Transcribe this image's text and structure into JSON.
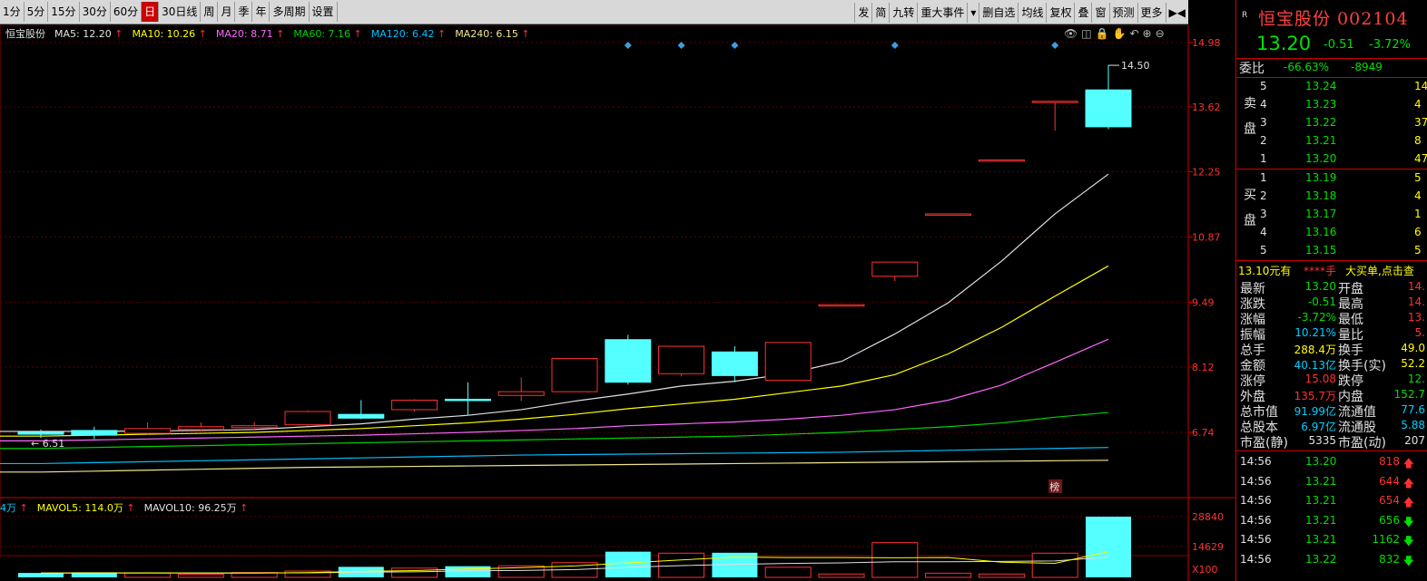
{
  "toolbar": {
    "left": [
      "1分",
      "5分",
      "15分",
      "30分",
      "60分",
      "日",
      "30日线",
      "周",
      "月",
      "季",
      "年",
      "多周期",
      "设置"
    ],
    "active_index": 5,
    "right": [
      "发",
      "简",
      "九转",
      "重大事件",
      "▾",
      "删自选",
      "均线",
      "复权",
      "叠",
      "窗",
      "预测",
      "更多",
      "▶◀"
    ]
  },
  "ma": {
    "name": "恒宝股份",
    "items": [
      {
        "label": "MA5: 12.20",
        "color": "#e0e0e0"
      },
      {
        "label": "MA10: 10.26",
        "color": "#ffff00"
      },
      {
        "label": "MA20: 8.71",
        "color": "#ff66ff"
      },
      {
        "label": "MA60: 7.16",
        "color": "#00d000"
      },
      {
        "label": "MA120: 6.42",
        "color": "#00bfff"
      },
      {
        "label": "MA240: 6.15",
        "color": "#f0e68c"
      }
    ],
    "arrow": "↑"
  },
  "chart_tools": [
    "👁",
    "◫",
    "🔒",
    "✋",
    "↶",
    "⊕",
    "⊖"
  ],
  "chart_data": {
    "type": "candlestick",
    "y_axis_labels": [
      "14.98",
      "13.62",
      "12.25",
      "10.87",
      "9.49",
      "8.12",
      "6.74"
    ],
    "y_axis_values": [
      14.98,
      13.62,
      12.25,
      10.87,
      9.49,
      8.12,
      6.74
    ],
    "high_label": "14.50",
    "low_label": "6.51",
    "low_arrow": "←",
    "candles": [
      {
        "o": 6.74,
        "c": 6.7,
        "h": 6.8,
        "l": 6.62
      },
      {
        "o": 6.78,
        "c": 6.68,
        "h": 6.86,
        "l": 6.6
      },
      {
        "o": 6.72,
        "c": 6.82,
        "h": 6.95,
        "l": 6.7
      },
      {
        "o": 6.8,
        "c": 6.86,
        "h": 6.95,
        "l": 6.76
      },
      {
        "o": 6.84,
        "c": 6.88,
        "h": 6.96,
        "l": 6.8
      },
      {
        "o": 6.9,
        "c": 7.18,
        "h": 7.2,
        "l": 6.88
      },
      {
        "o": 7.12,
        "c": 7.04,
        "h": 7.42,
        "l": 7.02
      },
      {
        "o": 7.22,
        "c": 7.42,
        "h": 7.44,
        "l": 7.18
      },
      {
        "o": 7.44,
        "c": 7.42,
        "h": 7.8,
        "l": 7.1
      },
      {
        "o": 7.52,
        "c": 7.6,
        "h": 7.9,
        "l": 7.4
      },
      {
        "o": 7.6,
        "c": 8.3,
        "h": 8.3,
        "l": 7.6
      },
      {
        "o": 8.7,
        "c": 7.8,
        "h": 8.8,
        "l": 7.75
      },
      {
        "o": 7.98,
        "c": 8.56,
        "h": 8.56,
        "l": 7.92
      },
      {
        "o": 8.44,
        "c": 7.94,
        "h": 8.56,
        "l": 7.8
      },
      {
        "o": 7.84,
        "c": 8.64,
        "h": 8.64,
        "l": 7.84
      },
      {
        "o": 9.44,
        "c": 9.44,
        "h": 9.44,
        "l": 9.44
      },
      {
        "o": 10.04,
        "c": 10.34,
        "h": 10.34,
        "l": 9.94
      },
      {
        "o": 11.36,
        "c": 11.36,
        "h": 11.36,
        "l": 11.36
      },
      {
        "o": 12.5,
        "c": 12.5,
        "h": 12.5,
        "l": 12.5
      },
      {
        "o": 13.74,
        "c": 13.74,
        "h": 13.74,
        "l": 13.12
      },
      {
        "o": 13.98,
        "c": 13.2,
        "h": 14.5,
        "l": 13.15
      }
    ],
    "markers_at": [
      11,
      12,
      13,
      16,
      19
    ],
    "mark_label": "榜",
    "ma5": [
      6.76,
      6.76,
      6.77,
      6.78,
      6.8,
      6.86,
      6.92,
      7.02,
      7.1,
      7.22,
      7.4,
      7.55,
      7.72,
      7.82,
      7.98,
      8.24,
      8.82,
      9.48,
      10.36,
      11.36,
      12.2
    ],
    "ma10": [
      6.66,
      6.68,
      6.7,
      6.72,
      6.74,
      6.78,
      6.82,
      6.88,
      6.94,
      7.02,
      7.12,
      7.24,
      7.34,
      7.44,
      7.58,
      7.72,
      7.96,
      8.4,
      8.96,
      9.62,
      10.26
    ],
    "ma20": [
      6.56,
      6.58,
      6.6,
      6.62,
      6.64,
      6.66,
      6.68,
      6.71,
      6.74,
      6.78,
      6.82,
      6.88,
      6.92,
      6.96,
      7.02,
      7.1,
      7.22,
      7.42,
      7.74,
      8.22,
      8.71
    ],
    "ma60": [
      6.4,
      6.42,
      6.44,
      6.46,
      6.48,
      6.5,
      6.52,
      6.54,
      6.56,
      6.58,
      6.6,
      6.62,
      6.64,
      6.66,
      6.7,
      6.74,
      6.8,
      6.86,
      6.94,
      7.06,
      7.16
    ],
    "ma120": [
      6.08,
      6.1,
      6.12,
      6.14,
      6.16,
      6.18,
      6.2,
      6.22,
      6.24,
      6.26,
      6.27,
      6.28,
      6.29,
      6.3,
      6.31,
      6.32,
      6.34,
      6.36,
      6.38,
      6.4,
      6.42
    ],
    "ma240": [
      5.9,
      5.92,
      5.94,
      5.96,
      5.98,
      6.0,
      6.01,
      6.02,
      6.03,
      6.04,
      6.05,
      6.06,
      6.07,
      6.08,
      6.09,
      6.1,
      6.11,
      6.12,
      6.13,
      6.14,
      6.15
    ],
    "volume": {
      "legend": [
        {
          "label": "4万",
          "color": "#00d0ff"
        },
        {
          "label": "MAVOL5: 114.0万",
          "color": "#ffff00"
        },
        {
          "label": "MAVOL10: 96.25万",
          "color": "#e0e0e0"
        }
      ],
      "axis_labels": [
        "28840",
        "14629",
        "X100"
      ],
      "axis_values": [
        28840,
        14629,
        0
      ],
      "bars": [
        2100,
        2400,
        2000,
        1500,
        2300,
        3000,
        5000,
        4400,
        5300,
        5500,
        7000,
        12200,
        11500,
        11700,
        4800,
        1600,
        16500,
        2000,
        1600,
        11500,
        28840
      ],
      "mavol5": [
        2000,
        2100,
        2150,
        2050,
        2060,
        2240,
        2840,
        3240,
        4000,
        4640,
        5440,
        6880,
        8280,
        9640,
        9440,
        9400,
        9320,
        9420,
        7200,
        6660,
        12220
      ],
      "mavol10": [
        2100,
        2100,
        2100,
        2100,
        2100,
        2150,
        2450,
        2650,
        3100,
        3300,
        3700,
        4800,
        5600,
        6200,
        6600,
        6900,
        7400,
        7400,
        7600,
        7800,
        9625
      ]
    }
  },
  "panel": {
    "r_label": "R",
    "name": "恒宝股份 002104",
    "price": "13.20",
    "change": "-0.51",
    "change_pct": "-3.72%",
    "weibi_label": "委比",
    "weibi_pct": "-66.63%",
    "weibi_val": "-8949",
    "sell_label": "卖盘",
    "buy_label": "买盘",
    "sells": [
      {
        "lvl": "5",
        "price": "13.24",
        "vol": "14"
      },
      {
        "lvl": "4",
        "price": "13.23",
        "vol": "4"
      },
      {
        "lvl": "3",
        "price": "13.22",
        "vol": "37"
      },
      {
        "lvl": "2",
        "price": "13.21",
        "vol": "8"
      },
      {
        "lvl": "1",
        "price": "13.20",
        "vol": "47"
      }
    ],
    "buys": [
      {
        "lvl": "1",
        "price": "13.19",
        "vol": "5"
      },
      {
        "lvl": "2",
        "price": "13.18",
        "vol": "4"
      },
      {
        "lvl": "3",
        "price": "13.17",
        "vol": "1"
      },
      {
        "lvl": "4",
        "price": "13.16",
        "vol": "6"
      },
      {
        "lvl": "5",
        "price": "13.15",
        "vol": "5"
      }
    ],
    "big_order": {
      "a": "13.10元有",
      "b": "****手",
      "c": "大买单,点击查"
    },
    "stats": [
      {
        "l": "最新",
        "v": "13.20",
        "vc": "green",
        "l2": "开盘",
        "v2": "14.",
        "v2c": "red"
      },
      {
        "l": "涨跌",
        "v": "-0.51",
        "vc": "green",
        "l2": "最高",
        "v2": "14.",
        "v2c": "red"
      },
      {
        "l": "涨幅",
        "v": "-3.72%",
        "vc": "green",
        "l2": "最低",
        "v2": "13.",
        "v2c": "red"
      },
      {
        "l": "振幅",
        "v": "10.21%",
        "vc": "cyan",
        "l2": "量比",
        "v2": "5.",
        "v2c": "red"
      },
      {
        "l": "总手",
        "v": "288.4万",
        "vc": "yel",
        "l2": "换手",
        "v2": "49.0",
        "v2c": "yel"
      },
      {
        "l": "金额",
        "v": "40.13亿",
        "vc": "cyan",
        "l2": "换手(实)",
        "v2": "52.2",
        "v2c": "yel"
      },
      {
        "l": "涨停",
        "v": "15.08",
        "vc": "red",
        "l2": "跌停",
        "v2": "12.",
        "v2c": "green"
      },
      {
        "l": "外盘",
        "v": "135.7万",
        "vc": "red",
        "l2": "内盘",
        "v2": "152.7",
        "v2c": "green"
      },
      {
        "l": "总市值",
        "v": "91.99亿",
        "vc": "cyan",
        "l2": "流通值",
        "v2": "77.6",
        "v2c": "cyan"
      },
      {
        "l": "总股本",
        "v": "6.97亿",
        "vc": "cyan",
        "l2": "流通股",
        "v2": "5.88",
        "v2c": "cyan"
      },
      {
        "l": "市盈(静)",
        "v": "5335",
        "vc": "wht",
        "l2": "市盈(动)",
        "v2": "207",
        "v2c": "wht"
      }
    ],
    "ticks": [
      {
        "t": "14:56",
        "p": "13.20",
        "v": "818",
        "dir": "up"
      },
      {
        "t": "14:56",
        "p": "13.21",
        "v": "644",
        "dir": "up"
      },
      {
        "t": "14:56",
        "p": "13.21",
        "v": "654",
        "dir": "up"
      },
      {
        "t": "14:56",
        "p": "13.21",
        "v": "656",
        "dir": "down"
      },
      {
        "t": "14:56",
        "p": "13.21",
        "v": "1162",
        "dir": "down"
      },
      {
        "t": "14:56",
        "p": "13.22",
        "v": "832",
        "dir": "down"
      }
    ]
  }
}
